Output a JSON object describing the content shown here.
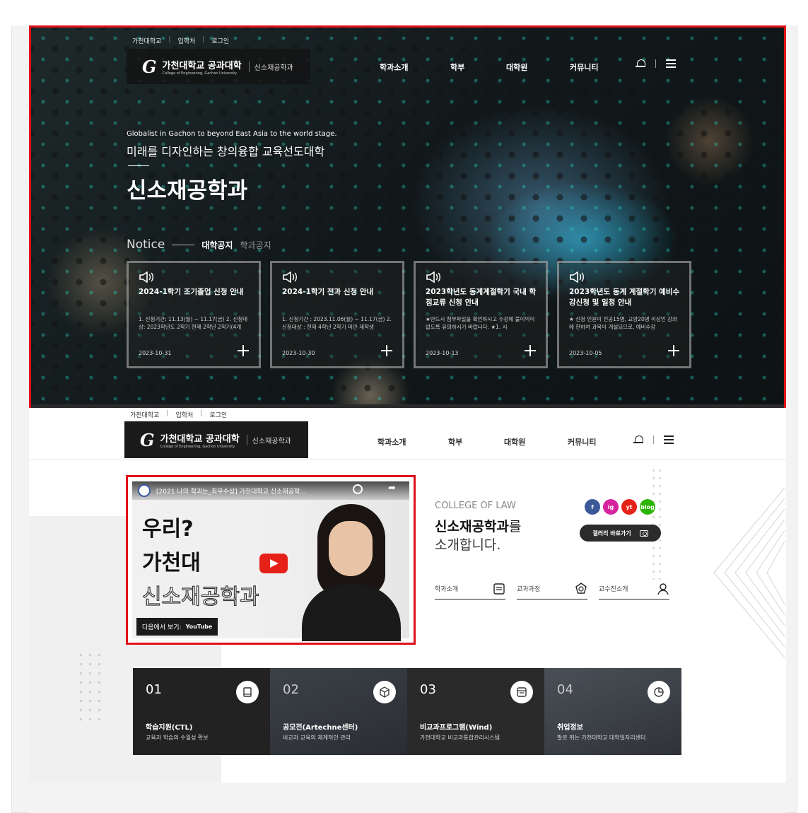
{
  "utility": {
    "items": [
      "가천대학교",
      "입학처",
      "로그인"
    ]
  },
  "logo": {
    "mark": "G",
    "name": "가천대학교 공과대학",
    "sub": "College of Engineering, Gachon University",
    "dept": "신소재공학과"
  },
  "gnb": [
    "학과소개",
    "학부",
    "대학원",
    "커뮤니티"
  ],
  "hero": {
    "slogan_en": "Globalist in Gachon to beyond East Asia to the world stage.",
    "slogan_ko": "미래를 디자인하는 창의융합 교육선도대학",
    "title": "신소재공학과",
    "notice_label": "Notice",
    "tabs": [
      "대학공지",
      "학과공지"
    ]
  },
  "notices": [
    {
      "title": "2024-1학기 조기졸업 신청 안내",
      "desc": "1. 신청기간: 11.13(월) ~ 11.17(금) 2. 신청대상: 2023학년도 2학기 현재 2학년 2학기(4개",
      "date": "2023-10-31"
    },
    {
      "title": "2024-1학기 전과 신청 안내",
      "desc": "1. 신청기간 : 2023.11.06(월) ~ 11.17(금) 2. 신청대상 : 현재 4학년 2학기 미만 재학생",
      "date": "2023-10-30"
    },
    {
      "title": "2023학년도 동계계절학기 국내 학점교류 신청 안내",
      "desc": "★반드시 첨부파일을 확인하시고 수강에 불이익이 없도록 유의하시기 바랍니다. ★1. 시",
      "date": "2023-10-13"
    },
    {
      "title": "2023학년도 동계 계절학기 예비수강신청 및 일정 안내",
      "desc": "★ 신청 인원이 전공15명, 교양20명 이상인 강좌에 한하여 과목이 개설되므로, 예비수강",
      "date": "2023-10-05"
    }
  ],
  "video": {
    "title": "[2021 나의 학과는_최우수상] 가천대학교 신소재공학...",
    "line1": "우리?",
    "line2": "가천대",
    "line3": "신소재공학과",
    "watch_label": "다음에서 보기:",
    "watch_brand": "YouTube"
  },
  "intro": {
    "sub": "COLLEGE OF LAW",
    "main_bold": "신소재공학과",
    "main_rest": "를",
    "main2": "소개합니다.",
    "sns": [
      "f",
      "ig",
      "yt",
      "blog"
    ],
    "sns_colors": [
      "#3b5998",
      "#d6249f",
      "#e62117",
      "#2db400"
    ],
    "gallery": "갤러리 바로가기",
    "links": [
      "학과소개",
      "교과과정",
      "교수진소개"
    ]
  },
  "quick": [
    {
      "num": "01",
      "title": "학습지원(CTL)",
      "desc": "교육과 학습의 수월성 확보",
      "icon": "book-icon"
    },
    {
      "num": "02",
      "title": "공모전(Artechne센터)",
      "desc": "비교과 교육의 체계적인 관리",
      "icon": "cube-icon"
    },
    {
      "num": "03",
      "title": "비교과프로그램(Wind)",
      "desc": "가천대학교 비교과통합관리시스템",
      "icon": "calendar-icon"
    },
    {
      "num": "04",
      "title": "취업정보",
      "desc": "발로 뛰는 가천대학교 대학일자리센터",
      "icon": "pie-chart-icon"
    }
  ]
}
